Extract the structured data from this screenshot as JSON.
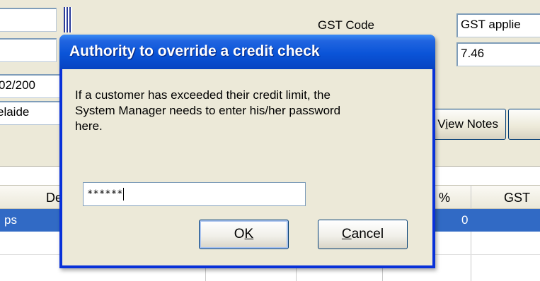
{
  "form": {
    "gst_code_label": "GST Code",
    "gst_code_value": "GST applie",
    "gst_rate_value": "7.46",
    "date_value": "02/200",
    "location_value": "elaide",
    "view_notes_button": "View Notes"
  },
  "grid": {
    "columns": [
      "De",
      "%",
      "GST"
    ],
    "row_first_cell": "ps",
    "row_percent_value": "0"
  },
  "dialog": {
    "title": "Authority to override a credit check",
    "message": "If a customer has exceeded their credit limit, the\nSystem Manager needs to enter his/her password\nhere.",
    "password_masked": "******",
    "ok_label": "OK",
    "cancel_label": "Cancel"
  },
  "icons": [
    "grid-lookup-icon"
  ],
  "colors": {
    "titlebar": "#0a54d8",
    "dialog_border": "#0831d9",
    "selection": "#316ac5",
    "window_bg": "#ece9d8"
  }
}
